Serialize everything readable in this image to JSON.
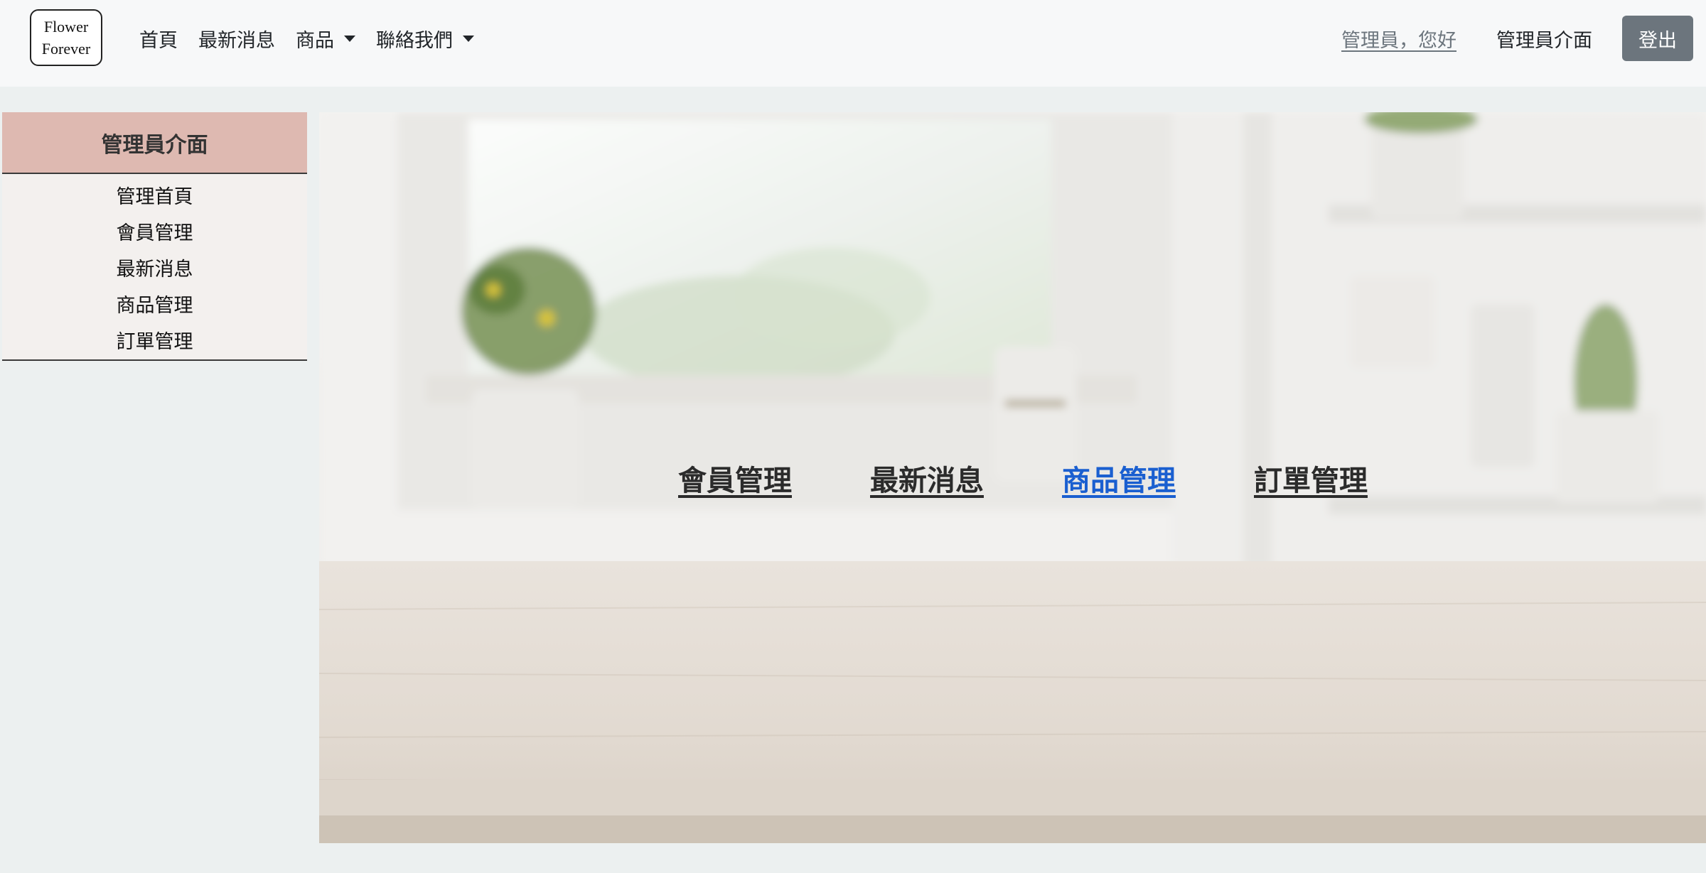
{
  "brand": {
    "line1": "Flower",
    "line2": "Forever"
  },
  "nav": {
    "home": "首頁",
    "news": "最新消息",
    "products": "商品",
    "contact": "聯絡我們"
  },
  "user": {
    "greeting": "管理員，您好",
    "admin_link": "管理員介面",
    "logout": "登出"
  },
  "sidebar": {
    "title": "管理員介面",
    "items": [
      {
        "label": "管理首頁"
      },
      {
        "label": "會員管理"
      },
      {
        "label": "最新消息"
      },
      {
        "label": "商品管理"
      },
      {
        "label": "訂單管理"
      }
    ]
  },
  "hero": {
    "links": [
      {
        "label": "會員管理"
      },
      {
        "label": "最新消息"
      },
      {
        "label": "商品管理"
      },
      {
        "label": "訂單管理"
      }
    ],
    "active_color": "#1a5fd0"
  },
  "colors": {
    "sidebar_header": "#deb9b1",
    "logout_button": "#6c757d"
  }
}
